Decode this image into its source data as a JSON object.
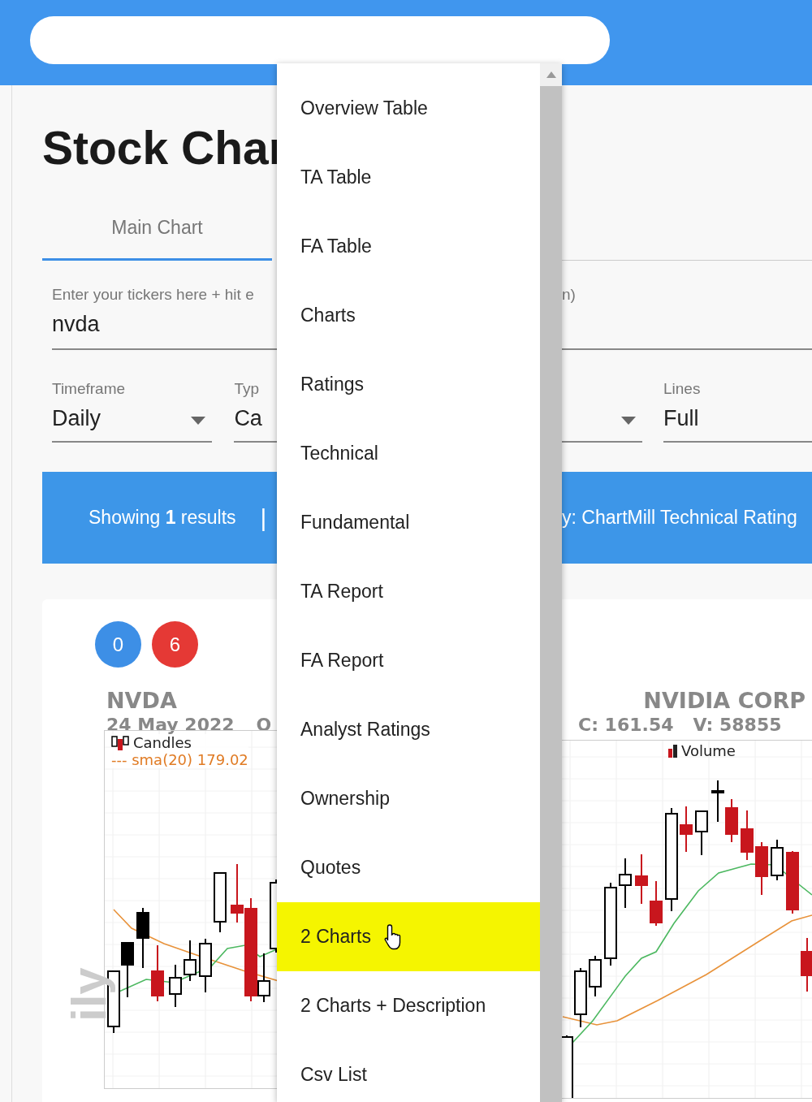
{
  "page": {
    "title": "Stock Char",
    "tabs": [
      {
        "label": "Main Chart",
        "selected": true
      }
    ],
    "ticker_field": {
      "label": "Enter your tickers here + hit e",
      "label_right": "n)",
      "value": "nvda"
    },
    "selects": [
      {
        "label": "Timeframe",
        "value": "Daily"
      },
      {
        "label": "Typ",
        "value": "Ca"
      }
    ],
    "lines_select": {
      "label": "Lines",
      "value": "Full"
    },
    "results_bar": {
      "text": "Showing **1** results",
      "separator": "|",
      "sort_text": "y: ChartMill Technical Rating"
    },
    "chart_card": {
      "badges": [
        {
          "text": "0",
          "color": "#3d8fe6"
        },
        {
          "text": "6",
          "color": "#e53935"
        }
      ],
      "symbol": "NVDA",
      "date": "24 May 2022",
      "open_fragment": "O",
      "legend": [
        "Candles",
        "--- sma(20) 179.02"
      ],
      "watermark": "ily",
      "company": "NVIDIA CORP",
      "close": "C: 161.54",
      "volume": "V: 58855",
      "volume_legend": "Volume"
    }
  },
  "menu": {
    "items": [
      {
        "label": "Overview Table",
        "selected": false
      },
      {
        "label": "TA Table",
        "selected": false
      },
      {
        "label": "FA Table",
        "selected": false
      },
      {
        "label": "Charts",
        "selected": false
      },
      {
        "label": "Ratings",
        "selected": false
      },
      {
        "label": "Technical",
        "selected": false
      },
      {
        "label": "Fundamental",
        "selected": false
      },
      {
        "label": "TA Report",
        "selected": false
      },
      {
        "label": "FA Report",
        "selected": false
      },
      {
        "label": "Analyst Ratings",
        "selected": false
      },
      {
        "label": "Ownership",
        "selected": false
      },
      {
        "label": "Quotes",
        "selected": false
      },
      {
        "label": "2 Charts",
        "selected": true
      },
      {
        "label": "2 Charts + Description",
        "selected": false
      },
      {
        "label": "Csv List",
        "selected": false
      }
    ]
  }
}
